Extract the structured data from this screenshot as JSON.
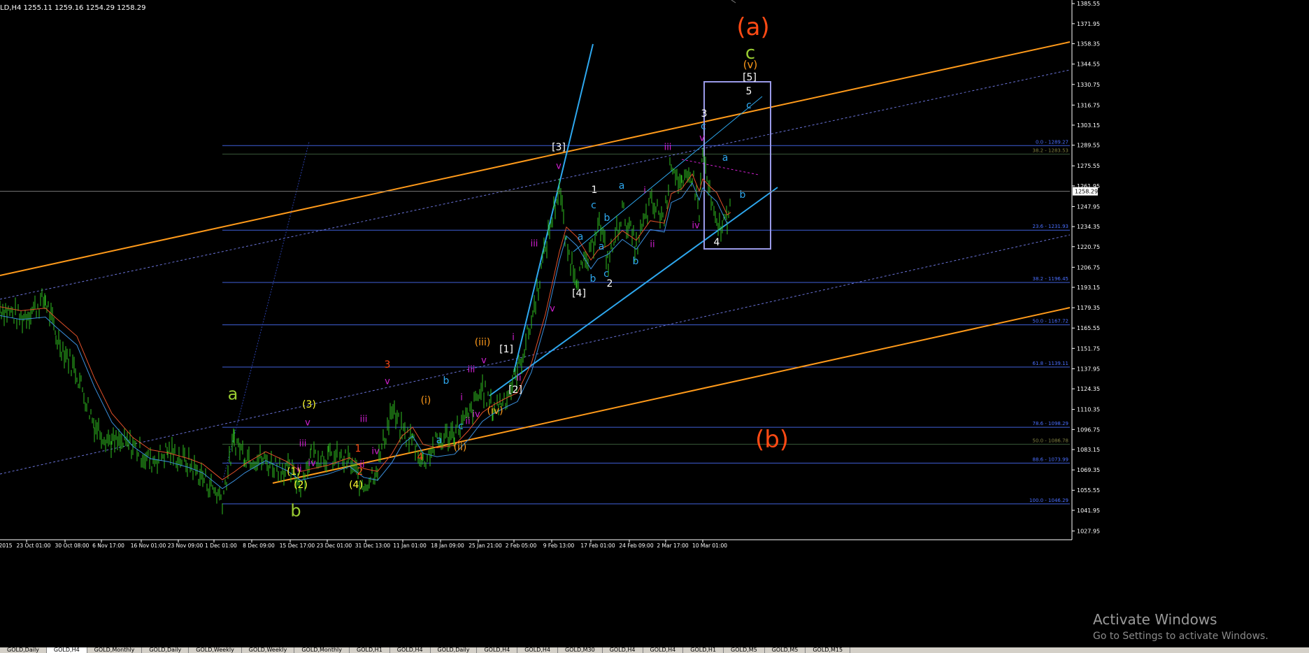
{
  "header": {
    "symbol": "LD,H4",
    "ohlc": "1255.11 1259.16 1254.29 1258.29"
  },
  "colors": {
    "background": "#000000",
    "candles": "#2fbf1f",
    "ma_fast": "#e0502a",
    "ma_slow": "#3a8fdc",
    "fib": "#3f5fd8",
    "channel_orange": "#ff9a1a",
    "trend_blue": "#2ea8ef"
  },
  "chart_data": {
    "type": "line",
    "title": "",
    "price_range": [
      1022,
      1388
    ],
    "y_ticks": [
      "1385.55",
      "1371.95",
      "1358.35",
      "1344.55",
      "1330.75",
      "1316.75",
      "1303.15",
      "1289.55",
      "1275.55",
      "1261.95",
      "1247.95",
      "1234.35",
      "1220.75",
      "1206.75",
      "1193.15",
      "1179.35",
      "1165.55",
      "1151.75",
      "1137.95",
      "1124.35",
      "1110.35",
      "1096.75",
      "1083.15",
      "1069.35",
      "1055.55",
      "1041.95",
      "1027.95"
    ],
    "current_price": "1258.29",
    "x_ticks": [
      "2015",
      "23 Oct 01:00",
      "30 Oct 08:00",
      "6 Nov 17:00",
      "16 Nov 01:00",
      "23 Nov 09:00",
      "1 Dec 01:00",
      "8 Dec 09:00",
      "15 Dec 17:00",
      "23 Dec 01:00",
      "31 Dec 13:00",
      "11 Jan 01:00",
      "18 Jan 09:00",
      "25 Jan 21:00",
      "2 Feb 05:00",
      "9 Feb 13:00",
      "17 Feb 01:00",
      "24 Feb 09:00",
      "2 Mar 17:00",
      "10 Mar 01:00"
    ],
    "fib_levels": [
      {
        "label": "0.0 - 1289.27",
        "value": 1289.27
      },
      {
        "label": "38.2 - 1283.53",
        "value": 1283.53
      },
      {
        "label": "23.6 - 1231.93",
        "value": 1231.93
      },
      {
        "label": "38.2 - 1196.45",
        "value": 1196.45
      },
      {
        "label": "50.0 - 1167.72",
        "value": 1167.72
      },
      {
        "label": "61.8 - 1139.11",
        "value": 1139.11
      },
      {
        "label": "78.6 - 1098.29",
        "value": 1098.29
      },
      {
        "label": "50.0 - 1086.78",
        "value": 1086.78
      },
      {
        "label": "88.6 - 1073.99",
        "value": 1073.99
      },
      {
        "label": "100.0 - 1046.29",
        "value": 1046.29
      }
    ],
    "price_path": [
      [
        0,
        1180
      ],
      [
        30,
        1172
      ],
      [
        65,
        1185
      ],
      [
        80,
        1160
      ],
      [
        110,
        1135
      ],
      [
        135,
        1100
      ],
      [
        160,
        1088
      ],
      [
        190,
        1086
      ],
      [
        215,
        1075
      ],
      [
        240,
        1082
      ],
      [
        270,
        1074
      ],
      [
        290,
        1064
      ],
      [
        318,
        1050
      ],
      [
        335,
        1090
      ],
      [
        350,
        1080
      ],
      [
        380,
        1075
      ],
      [
        410,
        1070
      ],
      [
        430,
        1060
      ],
      [
        445,
        1080
      ],
      [
        470,
        1078
      ],
      [
        500,
        1075
      ],
      [
        520,
        1058
      ],
      [
        540,
        1072
      ],
      [
        560,
        1110
      ],
      [
        575,
        1095
      ],
      [
        590,
        1090
      ],
      [
        605,
        1075
      ],
      [
        625,
        1088
      ],
      [
        650,
        1095
      ],
      [
        670,
        1105
      ],
      [
        690,
        1125
      ],
      [
        705,
        1110
      ],
      [
        725,
        1120
      ],
      [
        740,
        1135
      ],
      [
        760,
        1170
      ],
      [
        780,
        1220
      ],
      [
        800,
        1262
      ],
      [
        810,
        1220
      ],
      [
        825,
        1200
      ],
      [
        845,
        1215
      ],
      [
        855,
        1240
      ],
      [
        870,
        1210
      ],
      [
        890,
        1245
      ],
      [
        910,
        1220
      ],
      [
        930,
        1250
      ],
      [
        950,
        1240
      ],
      [
        960,
        1280
      ],
      [
        975,
        1260
      ],
      [
        990,
        1270
      ],
      [
        1000,
        1245
      ],
      [
        1005,
        1285
      ],
      [
        1015,
        1255
      ],
      [
        1025,
        1232
      ],
      [
        1040,
        1240
      ],
      [
        1045,
        1260
      ]
    ],
    "wave_labels": [
      {
        "text": "(a)",
        "color": "#ff4a14",
        "size": 34
      },
      {
        "text": "c",
        "color": "#9acd32",
        "size": 26
      },
      {
        "text": "(v)",
        "color": "#ff9a1a",
        "size": 15
      },
      {
        "text": "[5]",
        "color": "#ffffff",
        "size": 14
      },
      {
        "text": "5",
        "color": "#ffffff",
        "size": 14
      },
      {
        "text": "c",
        "color": "#2ea8ef",
        "size": 14
      },
      {
        "text": "3",
        "color": "#ffffff",
        "size": 14
      },
      {
        "text": "c",
        "color": "#2ea8ef",
        "size": 14
      },
      {
        "text": "v",
        "color": "#d01fd0",
        "size": 13
      },
      {
        "text": "iii",
        "color": "#d01fd0",
        "size": 13
      },
      {
        "text": "a",
        "color": "#2ea8ef",
        "size": 14
      },
      {
        "text": "b",
        "color": "#2ea8ef",
        "size": 14
      },
      {
        "text": "iv",
        "color": "#d01fd0",
        "size": 13
      },
      {
        "text": "4",
        "color": "#ffffff",
        "size": 14
      },
      {
        "text": "[3]",
        "color": "#ffffff",
        "size": 14
      },
      {
        "text": "v",
        "color": "#d01fd0",
        "size": 13
      },
      {
        "text": "1",
        "color": "#ffffff",
        "size": 14
      },
      {
        "text": "a",
        "color": "#2ea8ef",
        "size": 14
      },
      {
        "text": "i",
        "color": "#d01fd0",
        "size": 13
      },
      {
        "text": "c",
        "color": "#2ea8ef",
        "size": 14
      },
      {
        "text": "b",
        "color": "#2ea8ef",
        "size": 14
      },
      {
        "text": "iii",
        "color": "#d01fd0",
        "size": 13
      },
      {
        "text": "a",
        "color": "#2ea8ef",
        "size": 14
      },
      {
        "text": "a",
        "color": "#2ea8ef",
        "size": 14
      },
      {
        "text": "ii",
        "color": "#d01fd0",
        "size": 13
      },
      {
        "text": "b",
        "color": "#2ea8ef",
        "size": 14
      },
      {
        "text": "c",
        "color": "#2ea8ef",
        "size": 14
      },
      {
        "text": "b",
        "color": "#2ea8ef",
        "size": 14
      },
      {
        "text": "2",
        "color": "#ffffff",
        "size": 14
      },
      {
        "text": "[4]",
        "color": "#ffffff",
        "size": 14
      },
      {
        "text": "v",
        "color": "#d01fd0",
        "size": 13
      },
      {
        "text": "(iii)",
        "color": "#ff9a1a",
        "size": 14
      },
      {
        "text": "v",
        "color": "#d01fd0",
        "size": 13
      },
      {
        "text": "[1]",
        "color": "#ffffff",
        "size": 14
      },
      {
        "text": "i",
        "color": "#d01fd0",
        "size": 13
      },
      {
        "text": "iii",
        "color": "#d01fd0",
        "size": 13
      },
      {
        "text": "ii",
        "color": "#d01fd0",
        "size": 13
      },
      {
        "text": "[2]",
        "color": "#ffffff",
        "size": 14
      },
      {
        "text": "b",
        "color": "#2ea8ef",
        "size": 14
      },
      {
        "text": "i",
        "color": "#d01fd0",
        "size": 13
      },
      {
        "text": "c",
        "color": "#2ea8ef",
        "size": 14
      },
      {
        "text": "ii",
        "color": "#d01fd0",
        "size": 13
      },
      {
        "text": "iv",
        "color": "#d01fd0",
        "size": 13
      },
      {
        "text": "(iv)",
        "color": "#ff9a1a",
        "size": 14
      },
      {
        "text": "(i)",
        "color": "#ff9a1a",
        "size": 14
      },
      {
        "text": "a",
        "color": "#2ea8ef",
        "size": 14
      },
      {
        "text": "(ii)",
        "color": "#ff9a1a",
        "size": 14
      },
      {
        "text": "3",
        "color": "#ff4a14",
        "size": 14
      },
      {
        "text": "v",
        "color": "#d01fd0",
        "size": 13
      },
      {
        "text": "iii",
        "color": "#d01fd0",
        "size": 13
      },
      {
        "text": "iv",
        "color": "#d01fd0",
        "size": 13
      },
      {
        "text": "1",
        "color": "#ff4a14",
        "size": 14
      },
      {
        "text": "ii",
        "color": "#d01fd0",
        "size": 13
      },
      {
        "text": "2",
        "color": "#ff4a14",
        "size": 14
      },
      {
        "text": "4",
        "color": "#ff4a14",
        "size": 14
      },
      {
        "text": "(3)",
        "color": "#ffff33",
        "size": 14
      },
      {
        "text": "v",
        "color": "#d01fd0",
        "size": 13
      },
      {
        "text": "iii",
        "color": "#d01fd0",
        "size": 13
      },
      {
        "text": "iv",
        "color": "#d01fd0",
        "size": 13
      },
      {
        "text": "(1)",
        "color": "#ffff33",
        "size": 14
      },
      {
        "text": "ii",
        "color": "#d01fd0",
        "size": 13
      },
      {
        "text": "(2)",
        "color": "#ffff33",
        "size": 14
      },
      {
        "text": "(4)",
        "color": "#ffff33",
        "size": 14
      },
      {
        "text": "a",
        "color": "#9acd32",
        "size": 24
      },
      {
        "text": "b",
        "color": "#9acd32",
        "size": 24
      },
      {
        "text": "(b)",
        "color": "#ff4a14",
        "size": 34
      }
    ]
  },
  "watermark": {
    "line1": "Activate Windows",
    "line2": "Go to Settings to activate Windows."
  },
  "tabs": [
    "GOLD,Daily",
    "GOLD,H4",
    "GOLD,Monthly",
    "GOLD,Daily",
    "GOLD,Weekly",
    "GOLD,Weekly",
    "GOLD,Monthly",
    "GOLD,H1",
    "GOLD,H4",
    "GOLD,Daily",
    "GOLD,H4",
    "GOLD,H4",
    "GOLD,M30",
    "GOLD,H4",
    "GOLD,H4",
    "GOLD,H1",
    "GOLD,M5",
    "GOLD,M5",
    "GOLD,M15"
  ]
}
